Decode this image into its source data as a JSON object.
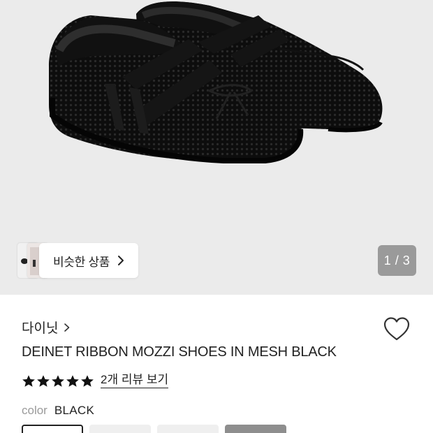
{
  "gallery": {
    "similar_label": "비슷한 상품",
    "page_counter": "1 / 3"
  },
  "product": {
    "brand": "다이닛",
    "title": "DEINET RIBBON MOZZI SHOES IN MESH BLACK",
    "rating_stars": 5,
    "review_link": "2개 리뷰 보기",
    "color_label": "color",
    "color_value": "BLACK",
    "swatches": [
      {
        "color": "#ffffff",
        "selected": true
      },
      {
        "color": "#efefef",
        "selected": false
      },
      {
        "color": "#efefef",
        "selected": false
      },
      {
        "color": "#8e8e8e",
        "selected": false
      }
    ]
  },
  "colors": {
    "gallery_bg": "#ebebeb",
    "counter_bg": "#9a9a9a",
    "text_primary": "#222222",
    "text_muted": "#9a9a9a"
  },
  "icons": {
    "wishlist": "heart-outline-icon",
    "brand_link": "chevron-right-icon",
    "similar": "chevron-right-icon",
    "star": "star-filled-icon"
  }
}
